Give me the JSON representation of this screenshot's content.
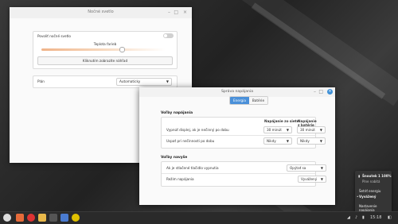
{
  "night_light_window": {
    "title": "Nočné svetlo",
    "enable_label": "Povoliť nočné svetlo",
    "temperature_label": "Teplota farieb",
    "preview_button": "Kliknutím zobrazíte náhľad",
    "schedule_label": "Plán",
    "schedule_value": "Automaticky",
    "enabled": false,
    "temperature_level": 0.7
  },
  "power_window": {
    "title": "Správa napájania",
    "tabs": [
      {
        "label": "Energia",
        "active": true
      },
      {
        "label": "Batérie",
        "active": false
      }
    ],
    "section1": {
      "header": "Voľby napájania",
      "col_ac": "Napájanie zo siete",
      "col_battery": "Napájanie z batérie",
      "rows": [
        {
          "label": "Vypnúť displej, ak je nečinný po dobu",
          "ac": "30 minút",
          "battery": "30 minút"
        },
        {
          "label": "Uspať pri nečinnosti po dobu",
          "ac": "Nikdy",
          "battery": "Nikdy"
        }
      ]
    },
    "section2": {
      "header": "Voľby navyše",
      "rows": [
        {
          "label": "Ak je stlačené tlačidlo vypnutia",
          "value": "Opýtať sa"
        },
        {
          "label": "Režim napájania",
          "value": "Vyvážený"
        }
      ]
    }
  },
  "battery_popup": {
    "title": "Zdroj napájania",
    "title_short": "Šnoutek 1 100%",
    "subtitle": "Plne nabitá",
    "item_1": "Šetriť energiu",
    "item_2": "Vyvážený",
    "item_3": "Nastavenie napájania"
  },
  "taskbar": {
    "clock": "15:18"
  }
}
